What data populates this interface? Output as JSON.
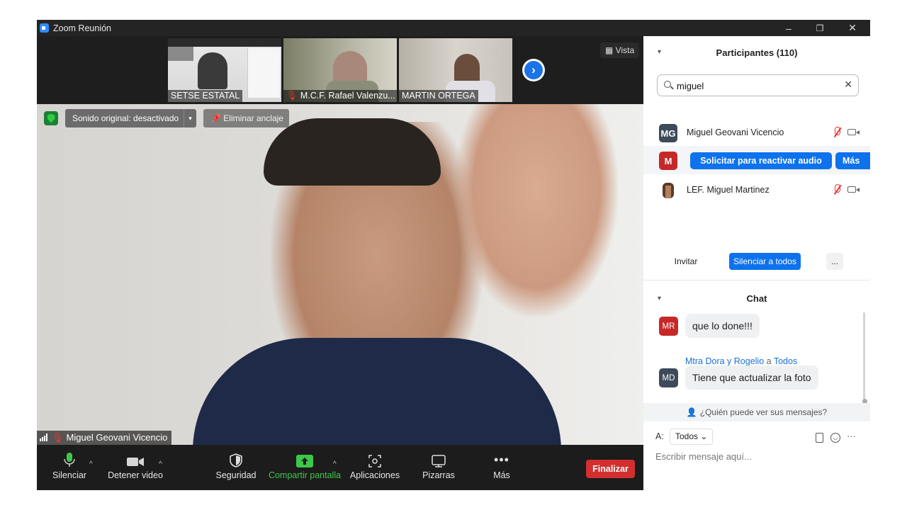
{
  "window": {
    "title": "Zoom Reunión",
    "controls": {
      "minimize": "–",
      "restore": "❐",
      "close": "✕"
    }
  },
  "video_strip": {
    "tiles": [
      {
        "label": "SETSE ESTATAL",
        "muted": false
      },
      {
        "label": "M.C.F. Rafael Valenzu...",
        "muted": true
      },
      {
        "label": "MARTIN ORTEGA",
        "muted": false
      }
    ],
    "next_icon": "›",
    "view_button": "Vista"
  },
  "main_video": {
    "sound_label": "Sonido original: desactivado",
    "unpin_label": "Eliminar anclaje",
    "speaker_name": "Miguel Geovani Vicencio"
  },
  "toolbar": {
    "mute": "Silenciar",
    "stop_video": "Detener video",
    "security": "Seguridad",
    "share_screen": "Compartir pantalla",
    "apps": "Aplicaciones",
    "whiteboards": "Pizarras",
    "more": "Más",
    "end": "Finalizar",
    "colors": {
      "share_green": "#3ec74a",
      "end_red": "#d32f2f"
    }
  },
  "participants": {
    "title": "Participantes (110)",
    "search_value": "miguel",
    "rows": [
      {
        "initials": "MG",
        "name": "Miguel Geovani Vicencio",
        "avatar_color": "#3c4a5a"
      },
      {
        "initials": "M",
        "request_label": "Solicitar para reactivar audio",
        "more_label": "Más",
        "avatar_color": "#c62828"
      },
      {
        "initials": "",
        "name": "LEF. Miguel Martinez",
        "avatar_color": "#6d4c41"
      }
    ],
    "invite": "Invitar",
    "mute_all": "Silenciar a todos",
    "more": "..."
  },
  "chat": {
    "title": "Chat",
    "messages": [
      {
        "initials": "MR",
        "text": "que lo done!!!",
        "avatar_color": "#c62828"
      },
      {
        "initials": "MD",
        "sender": "Mtra Dora y Rogelio",
        "to_word": "a",
        "to": "Todos",
        "text": "Tiene que actualizar la foto",
        "avatar_color": "#3c4a5a"
      }
    ],
    "who_can_see": "¿Quién puede ver sus mensajes?",
    "to_label": "A:",
    "to_value": "Todos",
    "input_placeholder": "Escribir mensaje aquí..."
  }
}
